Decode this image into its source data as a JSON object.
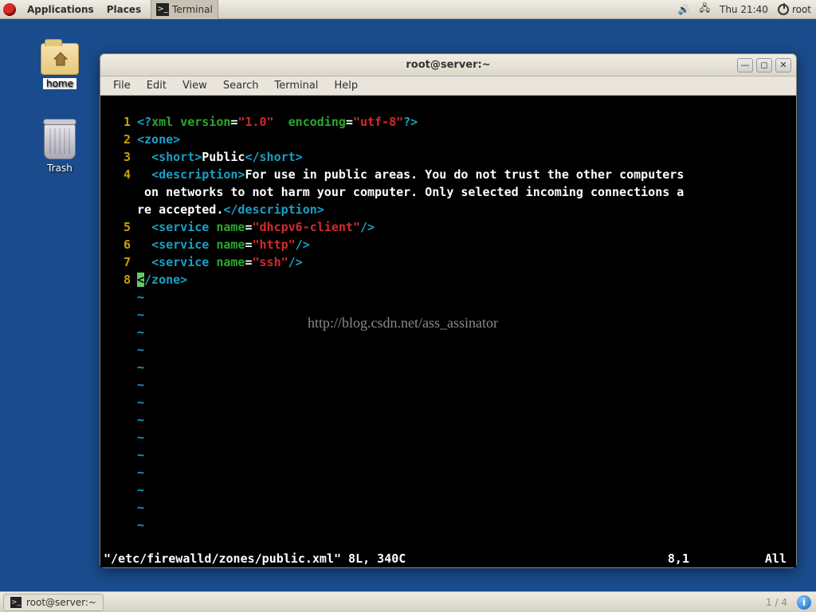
{
  "topbar": {
    "applications": "Applications",
    "places": "Places",
    "active_app": "Terminal",
    "clock": "Thu 21:40",
    "user": "root"
  },
  "desktop": {
    "home_label": "home",
    "trash_label": "Trash"
  },
  "window": {
    "title": "root@server:~",
    "menu": {
      "file": "File",
      "edit": "Edit",
      "view": "View",
      "search": "Search",
      "terminal": "Terminal",
      "help": "Help"
    }
  },
  "vim": {
    "line_numbers": [
      "1",
      "2",
      "3",
      "4",
      "",
      "",
      "5",
      "6",
      "7",
      "8"
    ],
    "l1": {
      "a": "<?",
      "b": "xml version",
      "c": "=",
      "d": "\"1.0\"",
      "e": "  ",
      "f": "encoding",
      "g": "=",
      "h": "\"utf-8\"",
      "i": "?>"
    },
    "l2": {
      "a": "<zone>"
    },
    "l3": {
      "a": "  ",
      "b": "<short>",
      "c": "Public",
      "d": "</short>"
    },
    "l4": {
      "a": "  ",
      "b": "<description>",
      "c": "For use in public areas. You do not trust the other computers"
    },
    "l4w1": {
      "a": " on networks to not harm your computer. Only selected incoming connections a"
    },
    "l4w2": {
      "a": "re accepted.",
      "b": "</description>"
    },
    "l5": {
      "a": "  ",
      "b": "<service ",
      "c": "name",
      "d": "=",
      "e": "\"dhcpv6-client\"",
      "f": "/>"
    },
    "l6": {
      "a": "  ",
      "b": "<service ",
      "c": "name",
      "d": "=",
      "e": "\"http\"",
      "f": "/>"
    },
    "l7": {
      "a": "  ",
      "b": "<service ",
      "c": "name",
      "d": "=",
      "e": "\"ssh\"",
      "f": "/>"
    },
    "l8": {
      "cursor": "<",
      "a": "/zone>"
    },
    "tilde": "~",
    "status": {
      "file": "\"/etc/firewalld/zones/public.xml\" 8L, 340C",
      "pos": "8,1",
      "scroll": "All"
    }
  },
  "watermark": "http://blog.csdn.net/ass_assinator",
  "bottombar": {
    "task_label": "root@server:~",
    "pager": "1 / 4"
  }
}
